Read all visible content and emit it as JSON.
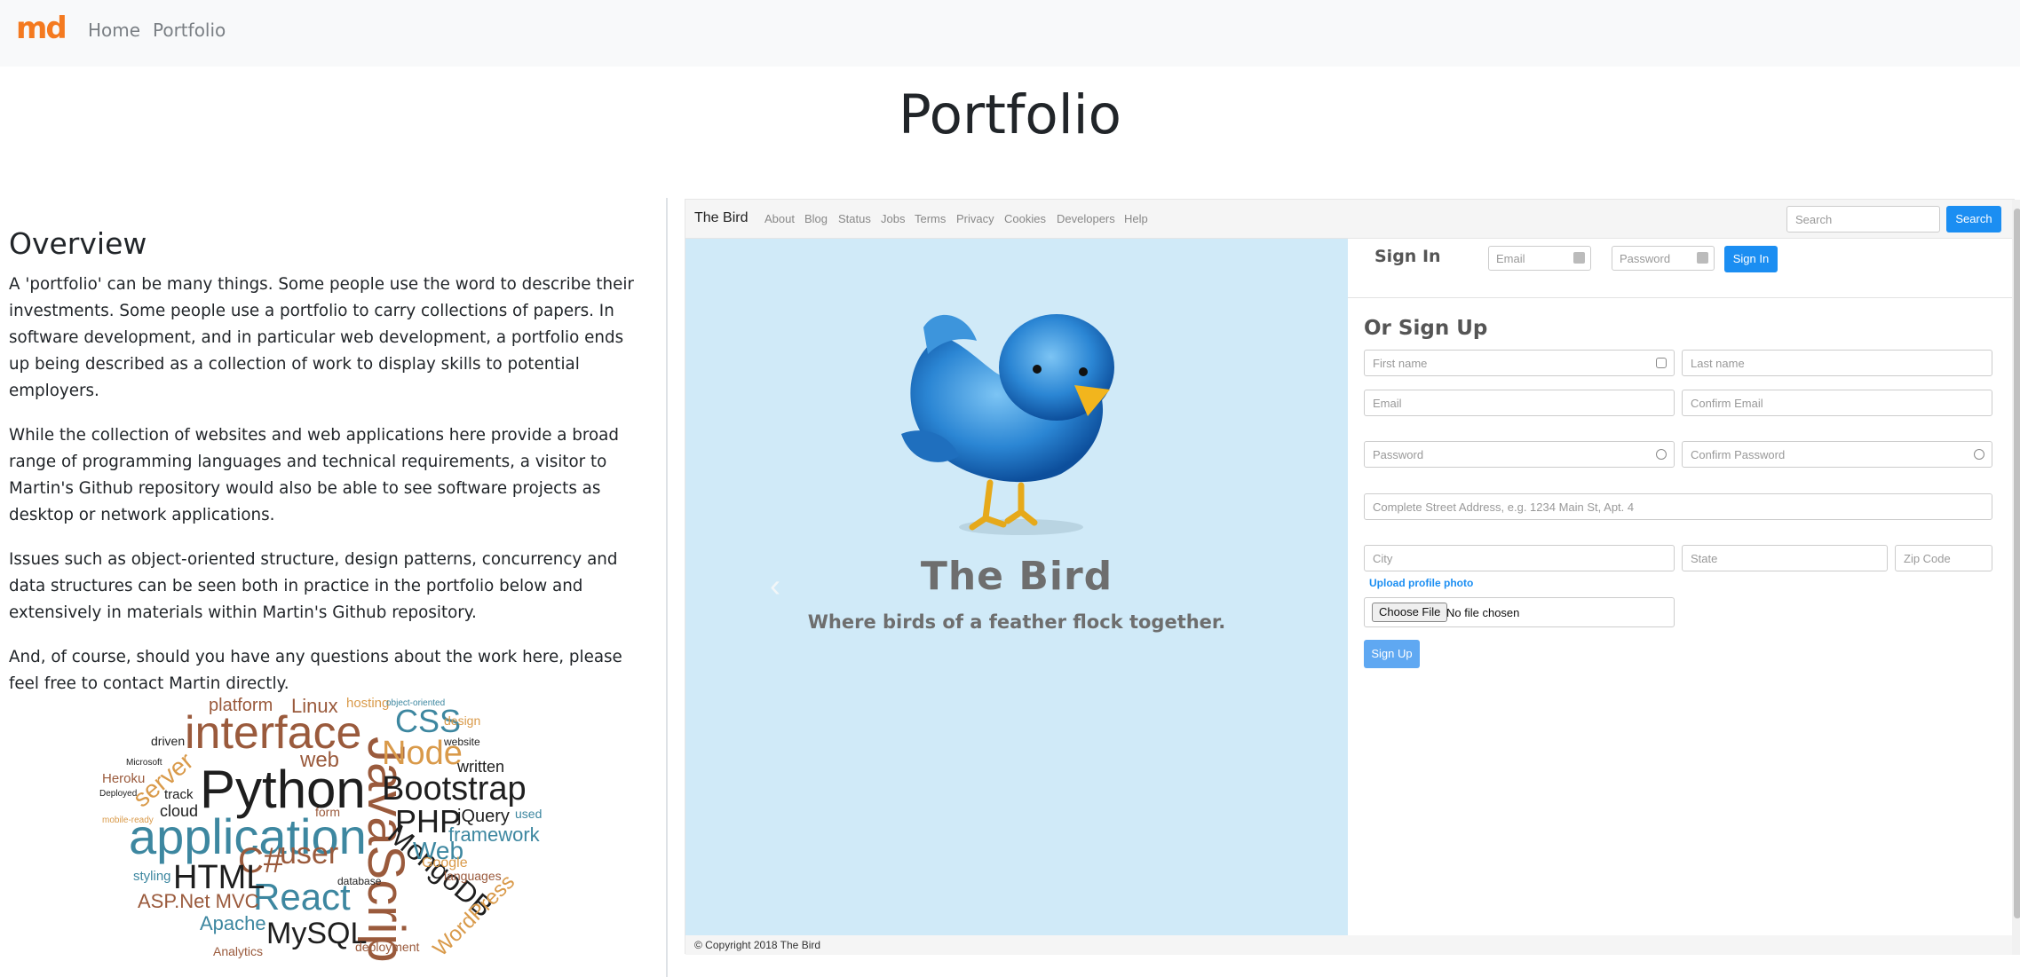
{
  "navbar": {
    "logo": "md",
    "links": [
      "Home",
      "Portfolio"
    ]
  },
  "page": {
    "title": "Portfolio"
  },
  "overview": {
    "heading": "Overview",
    "paragraphs": [
      "A 'portfolio' can be many things. Some people use the word to describe their investments. Some people use a portfolio to carry collections of papers. In software development, and in particular web development, a portfolio ends up being described as a collection of work to display skills to potential employers.",
      "While the collection of websites and web applications here provide a broad range of programming languages and technical requirements, a visitor to Martin's Github repository would also be able to see software projects as desktop or network applications.",
      "Issues such as object-oriented structure, design patterns, concurrency and data structures can be seen both in practice in the portfolio below and extensively in materials within Martin's Github repository.",
      "And, of course, should you have any questions about the work here, please feel free to contact Martin directly."
    ]
  },
  "wordcloud": {
    "words": [
      "Python",
      "JavaScript",
      "application",
      "interface",
      "Bootstrap",
      "React",
      "C#",
      "HTML",
      "PHP",
      "Node",
      "CSS",
      "MongoDB",
      "MySQL",
      "Web",
      "framework",
      "user",
      "server",
      "jQuery",
      "WordPress",
      "Linux",
      "Apache",
      "ASP.Net MVC",
      "web",
      "platform",
      "cloud",
      "Heroku",
      "written",
      "track",
      "hosting",
      "deployment",
      "database",
      "Analytics",
      "Google",
      "styling",
      "languages",
      "driven",
      "design",
      "website",
      "used",
      "form",
      "Microsoft",
      "mobile-ready",
      "Deployed",
      "object-oriented"
    ]
  },
  "screenshot": {
    "brand": "The Bird",
    "nav_links": [
      "About",
      "Blog",
      "Status",
      "Jobs",
      "Terms",
      "Privacy",
      "Cookies",
      "Developers",
      "Help"
    ],
    "search_placeholder": "Search",
    "search_button": "Search",
    "hero_title": "The Bird",
    "hero_subtitle": "Where birds of a feather flock together.",
    "prev_arrow": "‹",
    "signin": {
      "title": "Sign In",
      "email_placeholder": "Email",
      "password_placeholder": "Password",
      "button": "Sign In"
    },
    "signup": {
      "title": "Or Sign Up",
      "first_name": "First name",
      "last_name": "Last name",
      "email": "Email",
      "confirm_email": "Confirm Email",
      "password": "Password",
      "confirm_password": "Confirm Password",
      "address": "Complete Street Address, e.g. 1234 Main St, Apt. 4",
      "city": "City",
      "state": "State",
      "zip": "Zip Code",
      "upload_label": "Upload profile photo",
      "file_button": "Choose File",
      "file_status": "No file chosen",
      "button": "Sign Up"
    },
    "footer": "©   Copyright 2018 The Bird"
  },
  "colors": {
    "logo": "#f47a20",
    "hero_bg": "#d0eaf8",
    "primary_button": "#1b8ef2"
  }
}
